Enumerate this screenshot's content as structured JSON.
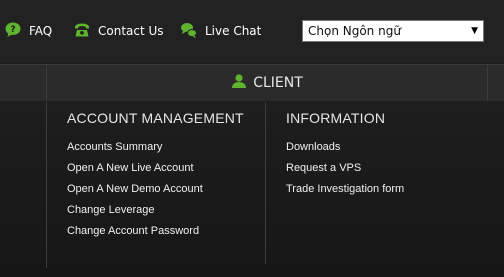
{
  "topbar": {
    "links": [
      {
        "label": "FAQ",
        "icon": "help-bubble-icon"
      },
      {
        "label": "Contact Us",
        "icon": "phone-icon"
      },
      {
        "label": "Live Chat",
        "icon": "chat-bubbles-icon"
      }
    ],
    "language_select": {
      "value": "Chọn Ngôn ngữ"
    }
  },
  "nav": {
    "client_label": "CLIENT",
    "client_icon": "user-icon"
  },
  "menu": {
    "account_management": {
      "heading": "ACCOUNT MANAGEMENT",
      "items": [
        "Accounts Summary",
        "Open A New Live Account",
        "Open A New Demo Account",
        "Change Leverage",
        "Change Account Password"
      ]
    },
    "information": {
      "heading": "INFORMATION",
      "items": [
        "Downloads",
        "Request a VPS",
        "Trade Investigation form"
      ]
    }
  },
  "colors": {
    "accent_green": "#5fb32e",
    "background": "#1c1c1c",
    "text": "#ffffff"
  }
}
